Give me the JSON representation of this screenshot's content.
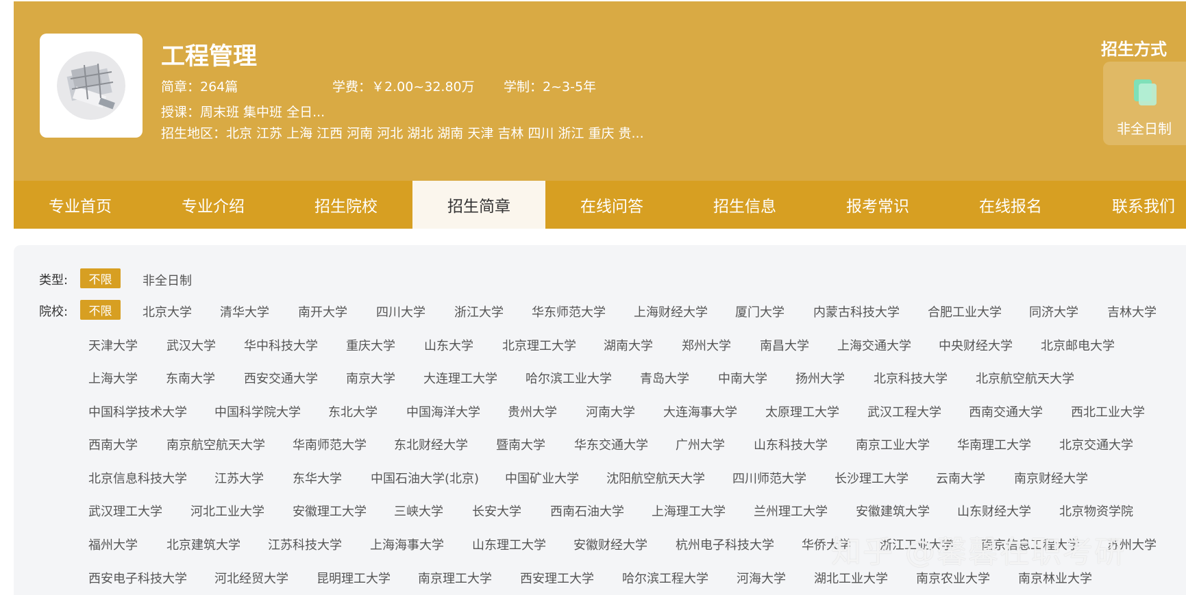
{
  "major": {
    "title": "工程管理",
    "brochure": "简章：264篇",
    "tuition": "学费：￥2.00~32.80万",
    "duration": "学制：2~3-5年",
    "teaching": "授课：周末班 集中班 全日...",
    "regions": "招生地区：北京 江苏 上海 江西 河南 河北 湖北 湖南 天津 吉林 四川 浙江 重庆 贵..."
  },
  "mode": {
    "title": "招生方式",
    "label": "非全日制"
  },
  "nav": [
    "专业首页",
    "专业介绍",
    "招生院校",
    "招生简章",
    "在线问答",
    "招生信息",
    "报考常识",
    "在线报名",
    "联系我们"
  ],
  "nav_active": "招生简章",
  "filters": {
    "type_label": "类型:",
    "type_all": "不限",
    "type_option": "非全日制",
    "school_label": "院校:",
    "school_all": "不限",
    "row1": [
      "北京大学",
      "清华大学",
      "南开大学",
      "四川大学",
      "浙江大学",
      "华东师范大学",
      "上海财经大学",
      "厦门大学",
      "内蒙古科技大学",
      "合肥工业大学",
      "同济大学",
      "吉林大学"
    ],
    "row2": [
      "天津大学",
      "武汉大学",
      "华中科技大学",
      "重庆大学",
      "山东大学",
      "北京理工大学",
      "湖南大学",
      "郑州大学",
      "南昌大学",
      "上海交通大学",
      "中央财经大学",
      "北京邮电大学"
    ],
    "row3": [
      "上海大学",
      "东南大学",
      "西安交通大学",
      "南京大学",
      "大连理工大学",
      "哈尔滨工业大学",
      "青岛大学",
      "中南大学",
      "扬州大学",
      "北京科技大学",
      "北京航空航天大学"
    ],
    "row4": [
      "中国科学技术大学",
      "中国科学院大学",
      "东北大学",
      "中国海洋大学",
      "贵州大学",
      "河南大学",
      "大连海事大学",
      "太原理工大学",
      "武汉工程大学",
      "西南交通大学",
      "西北工业大学"
    ],
    "row5": [
      "西南大学",
      "南京航空航天大学",
      "华南师范大学",
      "东北财经大学",
      "暨南大学",
      "华东交通大学",
      "广州大学",
      "山东科技大学",
      "南京工业大学",
      "华南理工大学",
      "北京交通大学"
    ],
    "row6": [
      "北京信息科技大学",
      "江苏大学",
      "东华大学",
      "中国石油大学(北京)",
      "中国矿业大学",
      "沈阳航空航天大学",
      "四川师范大学",
      "长沙理工大学",
      "云南大学",
      "南京财经大学"
    ],
    "row7": [
      "武汉理工大学",
      "河北工业大学",
      "安徽理工大学",
      "三峡大学",
      "长安大学",
      "西南石油大学",
      "上海理工大学",
      "兰州理工大学",
      "安徽建筑大学",
      "山东财经大学",
      "北京物资学院"
    ],
    "row8": [
      "福州大学",
      "北京建筑大学",
      "江苏科技大学",
      "上海海事大学",
      "山东理工大学",
      "安徽财经大学",
      "杭州电子科技大学",
      "华侨大学",
      "浙江工业大学",
      "南京信息工程大学",
      "苏州大学"
    ],
    "row9": [
      "西安电子科技大学",
      "河北经贸大学",
      "昆明理工大学",
      "南京理工大学",
      "西安理工大学",
      "哈尔滨工程大学",
      "河海大学",
      "湖北工业大学",
      "南京农业大学",
      "南京林业大学"
    ]
  },
  "watermark": "知乎 @馨馨在职考研"
}
